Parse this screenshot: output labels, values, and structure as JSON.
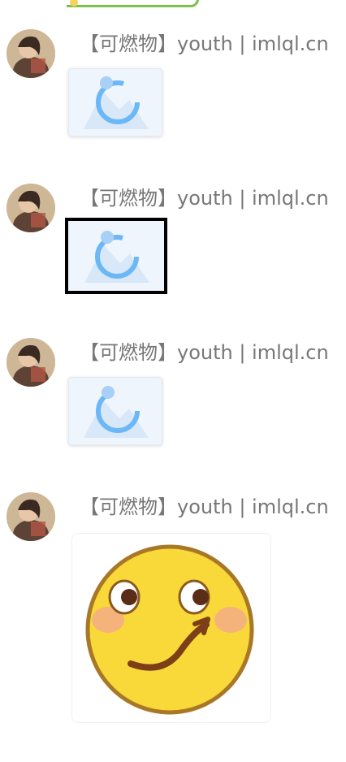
{
  "messages": [
    {
      "sender": "【可燃物】youth | imlql.cn",
      "content_type": "loading-image"
    },
    {
      "sender": "【可燃物】youth | imlql.cn",
      "content_type": "loading-image",
      "selected": true
    },
    {
      "sender": "【可燃物】youth | imlql.cn",
      "content_type": "loading-image"
    },
    {
      "sender": "【可燃物】youth | imlql.cn",
      "content_type": "emoji",
      "emoji": "smirk-emoji"
    }
  ],
  "colors": {
    "sender_text": "#777777",
    "loading_blue": "#6cb7f5",
    "emoji_yellow": "#f9d83a",
    "selection_border": "#000000"
  }
}
